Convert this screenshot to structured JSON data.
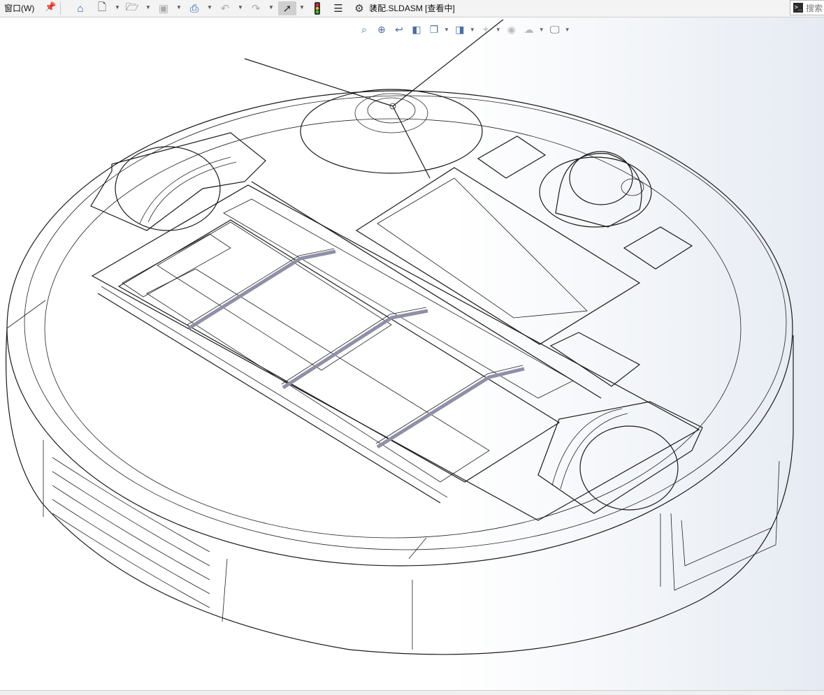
{
  "menu": {
    "window_label": "窗口(W)"
  },
  "toolbar": {
    "icons": [
      "pin-icon",
      "home-icon",
      "new-document-icon",
      "open-icon",
      "save-icon",
      "print-icon",
      "undo-icon",
      "redo-icon",
      "select-pointer-icon",
      "rebuild-traffic-light-icon",
      "file-properties-icon",
      "options-gear-icon"
    ]
  },
  "document": {
    "title": "装配.SLDASM [查看中]"
  },
  "search": {
    "placeholder": "搜索"
  },
  "heads_up_toolbar": {
    "icons": [
      "zoom-to-fit-icon",
      "zoom-to-area-icon",
      "previous-view-icon",
      "section-view-icon",
      "view-orientation-icon",
      "display-style-icon",
      "hide-show-items-icon",
      "edit-appearance-icon",
      "apply-scene-icon",
      "view-settings-icon"
    ]
  },
  "model": {
    "pad_color": "#f5f300",
    "cavity_color": "#8c90a6",
    "cavity_light_color": "#a9a7c9"
  }
}
